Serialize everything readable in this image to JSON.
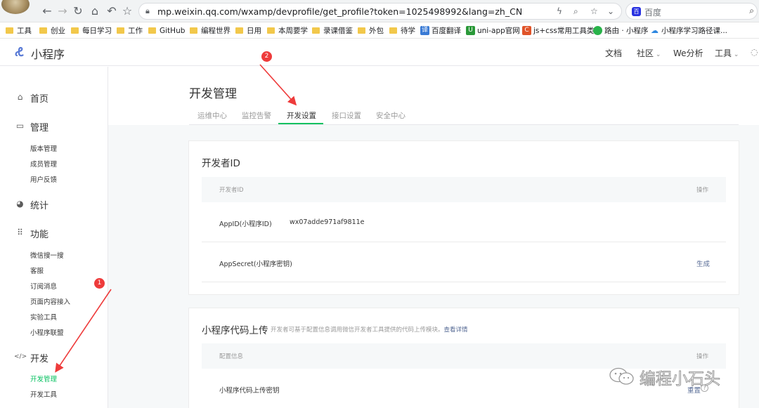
{
  "browser": {
    "url": "mp.weixin.qq.com/wxamp/devprofile/get_profile?token=1025498992&lang=zh_CN",
    "search_placeholder": "百度",
    "bookmarks": [
      "工具",
      "创业",
      "每日学习",
      "工作",
      "GitHub",
      "编程世界",
      "日用",
      "本周要学",
      "录课借鉴",
      "外包",
      "待学",
      "百度翻译",
      "uni-app官网",
      "js+css常用工具类",
      "路由 · 小程序",
      "小程序学习路径课..."
    ],
    "bookmark_icons": {
      "translate": "译",
      "uniapp": "U",
      "css": "C"
    }
  },
  "header": {
    "app_title": "小程序",
    "nav": [
      "文档",
      "社区",
      "We分析",
      "工具"
    ]
  },
  "sidebar": {
    "sections": [
      {
        "label": "首页",
        "icon": "home-icon",
        "items": []
      },
      {
        "label": "管理",
        "icon": "inbox-icon",
        "items": [
          "版本管理",
          "成员管理",
          "用户反馈"
        ]
      },
      {
        "label": "统计",
        "icon": "pie-chart-icon",
        "items": []
      },
      {
        "label": "功能",
        "icon": "grid-icon",
        "items": [
          "微信搜一搜",
          "客服",
          "订阅消息",
          "页面内容接入",
          "实验工具",
          "小程序联盟"
        ]
      },
      {
        "label": "开发",
        "icon": "code-icon",
        "items": [
          "开发管理",
          "开发工具"
        ]
      }
    ],
    "active_item": "开发管理",
    "code_glyph": "</>"
  },
  "main": {
    "title": "开发管理",
    "tabs": [
      "运维中心",
      "监控告警",
      "开发设置",
      "接口设置",
      "安全中心"
    ],
    "active_tab": "开发设置",
    "developer_card": {
      "title": "开发者ID",
      "col_left": "开发者ID",
      "col_right": "操作",
      "appid_label": "AppID(小程序ID)",
      "appid_value": "wx07adde971af9811e",
      "secret_label": "AppSecret(小程序密钥)",
      "secret_action": "生成"
    },
    "upload_card": {
      "title": "小程序代码上传",
      "desc": "开发者可基于配置信息调用微信开发者工具提供的代码上传模块。",
      "desc_link": "查看详情",
      "col_left": "配置信息",
      "col_right": "操作",
      "row_label": "小程序代码上传密钥",
      "row_action": "重置"
    }
  },
  "annotations": {
    "marker_1": "1",
    "marker_2": "2"
  },
  "watermark": "编程小石头",
  "colors": {
    "accent": "#07c160",
    "link": "#576b95",
    "marker": "#ee3b3b"
  }
}
